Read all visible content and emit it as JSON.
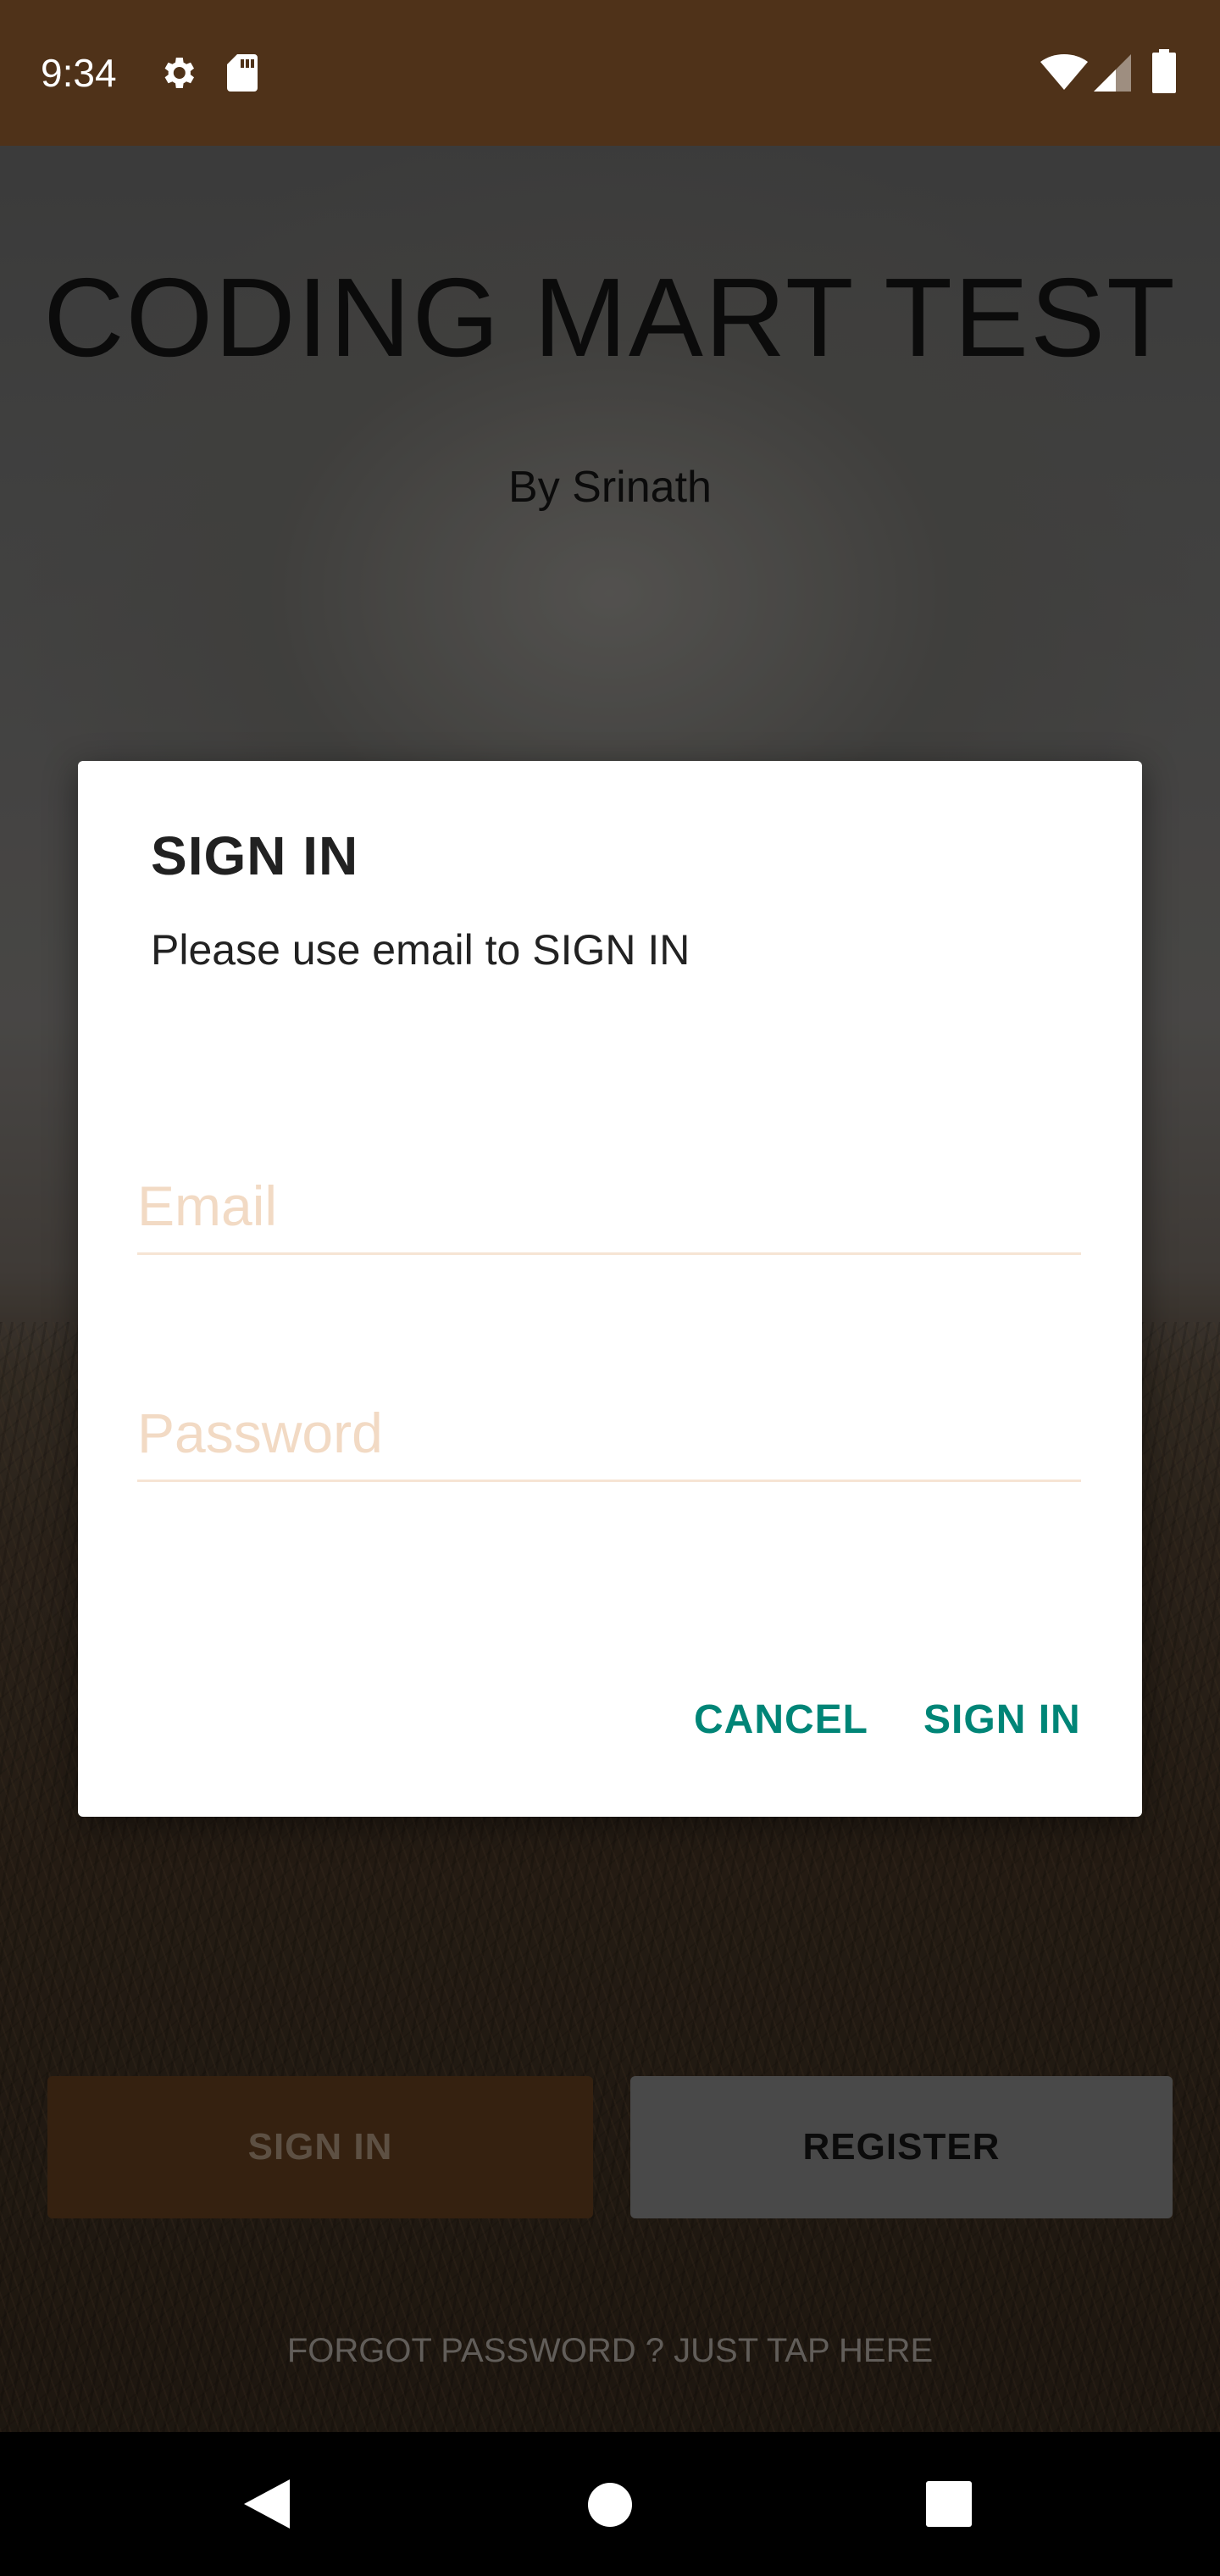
{
  "status_bar": {
    "time": "9:34",
    "icons": [
      "gear-icon",
      "sd-card-icon",
      "wifi-icon",
      "signal-icon",
      "battery-icon"
    ],
    "background_color": "#4f3219"
  },
  "app": {
    "title": "CODING MART TEST",
    "subtitle": "By Srinath"
  },
  "background_buttons": {
    "signin_label": "SIGN IN",
    "register_label": "REGISTER",
    "forgot_password": "FORGOT PASSWORD ? JUST TAP HERE"
  },
  "dialog": {
    "title": "SIGN IN",
    "message": "Please use email to SIGN IN",
    "email": {
      "value": "",
      "placeholder": "Email"
    },
    "password": {
      "value": "",
      "placeholder": "Password"
    },
    "cancel_label": "CANCEL",
    "signin_label": "SIGN IN",
    "accent_color": "#008577"
  },
  "nav_bar": {
    "icons": [
      "back-icon",
      "home-icon",
      "recents-icon"
    ]
  }
}
